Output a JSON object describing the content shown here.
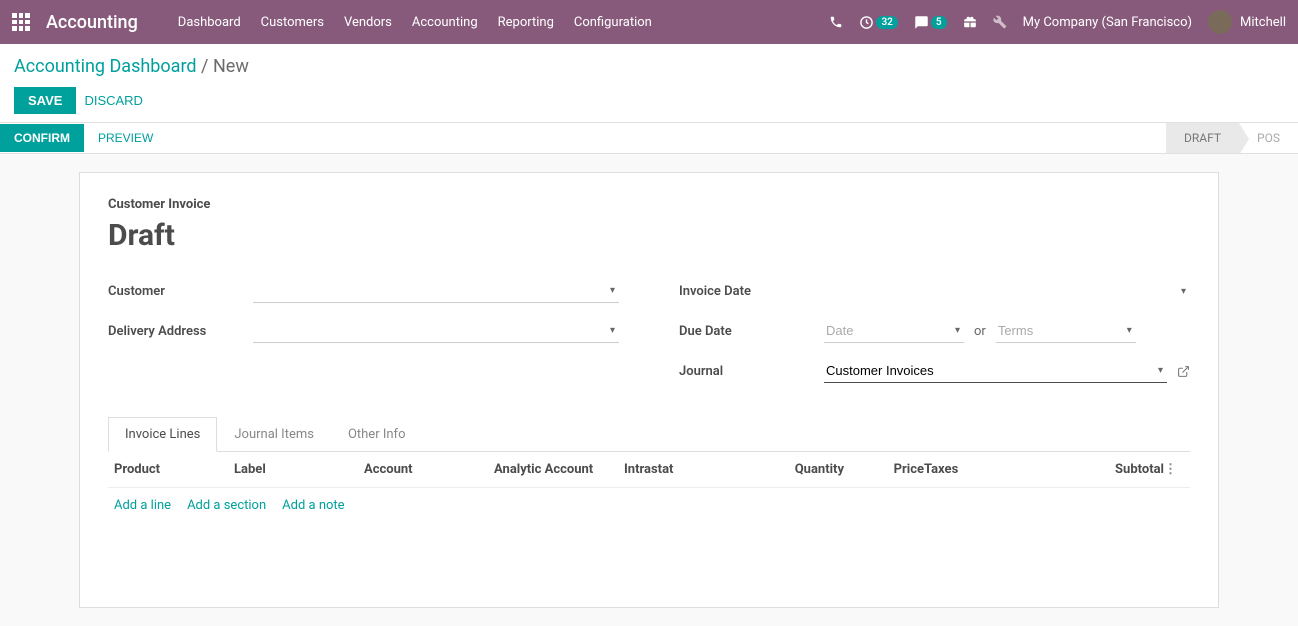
{
  "topbar": {
    "brand": "Accounting",
    "menu": [
      "Dashboard",
      "Customers",
      "Vendors",
      "Accounting",
      "Reporting",
      "Configuration"
    ],
    "clock_badge": "32",
    "chat_badge": "5",
    "company": "My Company (San Francisco)",
    "user": "Mitchell"
  },
  "breadcrumb": {
    "parent": "Accounting Dashboard",
    "sep": "/",
    "current": "New"
  },
  "actions": {
    "save": "SAVE",
    "discard": "DISCARD"
  },
  "statusbar": {
    "confirm": "CONFIRM",
    "preview": "PREVIEW",
    "stages": [
      "DRAFT",
      "POS"
    ]
  },
  "sheet": {
    "label": "Customer Invoice",
    "title": "Draft",
    "fields": {
      "customer": "Customer",
      "delivery_address": "Delivery Address",
      "invoice_date": "Invoice Date",
      "due_date": "Due Date",
      "due_date_placeholder": "Date",
      "due_or": "or",
      "terms_placeholder": "Terms",
      "journal": "Journal",
      "journal_value": "Customer Invoices"
    },
    "tabs": [
      "Invoice Lines",
      "Journal Items",
      "Other Info"
    ],
    "columns": {
      "product": "Product",
      "label": "Label",
      "account": "Account",
      "analytic": "Analytic Account",
      "intrastat": "Intrastat",
      "quantity": "Quantity",
      "price": "Price",
      "taxes": "Taxes",
      "subtotal": "Subtotal"
    },
    "addlinks": {
      "line": "Add a line",
      "section": "Add a section",
      "note": "Add a note"
    }
  }
}
